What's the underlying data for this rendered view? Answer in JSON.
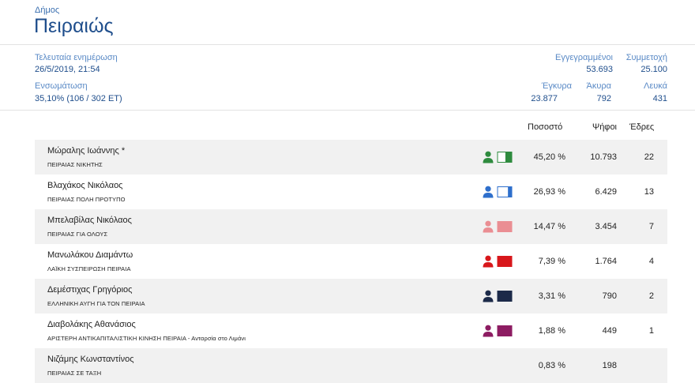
{
  "header": {
    "kind": "Δήμος",
    "title": "Πειραιώς"
  },
  "info": {
    "last_update_label": "Τελευταία ενημέρωση",
    "last_update_value": "26/5/2019, 21:54",
    "integration_label": "Ενσωμάτωση",
    "integration_value": "35,10% (106 / 302 ΕΤ)",
    "registered_label": "Εγγεγραμμένοι",
    "registered_value": "53.693",
    "turnout_label": "Συμμετοχή",
    "turnout_value": "25.100",
    "valid_label": "Έγκυρα",
    "valid_value": "23.877",
    "invalid_label": "Άκυρα",
    "invalid_value": "792",
    "blank_label": "Λευκά",
    "blank_value": "431"
  },
  "table": {
    "headers": {
      "percent": "Ποσοστό",
      "votes": "Ψήφοι",
      "seats": "Έδρες"
    },
    "rows": [
      {
        "name": "Μώραλης Ιωάννης *",
        "party": "ΠΕΙΡΑΙΑΣ ΝΙΚΗΤΗΣ",
        "color": "#2e8b3e",
        "fill": 0.45,
        "percent": "45,20 %",
        "votes": "10.793",
        "seats": "22"
      },
      {
        "name": "Βλαχάκος Νικόλαος",
        "party": "ΠΕΙΡΑΙΑΣ ΠΟΛΗ ΠΡΟΤΥΠΟ",
        "color": "#2e6fcc",
        "fill": 0.27,
        "percent": "26,93 %",
        "votes": "6.429",
        "seats": "13"
      },
      {
        "name": "Μπελαβίλας Νικόλαος",
        "party": "ΠΕΙΡΑΙΑΣ ΓΙΑ ΟΛΟΥΣ",
        "color": "#ea8e93",
        "fill": 1.0,
        "percent": "14,47 %",
        "votes": "3.454",
        "seats": "7"
      },
      {
        "name": "Μανωλάκου Διαμάντω",
        "party": "ΛΑΪΚΗ ΣΥΣΠΕΙΡΩΣΗ ΠΕΙΡΑΙΑ",
        "color": "#d8171b",
        "fill": 1.0,
        "percent": "7,39 %",
        "votes": "1.764",
        "seats": "4"
      },
      {
        "name": "Δεμέστιχας Γρηγόριος",
        "party": "ΕΛΛΗΝΙΚΗ ΑΥΓΗ ΓΙΑ ΤΟΝ ΠΕΙΡΑΙΑ",
        "color": "#1c2a49",
        "fill": 1.0,
        "percent": "3,31 %",
        "votes": "790",
        "seats": "2"
      },
      {
        "name": "Διαβολάκης Αθανάσιος",
        "party": "ΑΡΙΣΤΕΡΗ ΑΝΤΙΚΑΠΙΤΑΛΙΣΤΙΚΗ ΚΙΝΗΣΗ ΠΕΙΡΑΙΑ - Ανταρσία στο Λιμάνι",
        "color": "#8d1c62",
        "fill": 1.0,
        "percent": "1,88 %",
        "votes": "449",
        "seats": "1"
      },
      {
        "name": "Νιζάμης Κωνσταντίνος",
        "party": "ΠΕΙΡΑΙΑΣ ΣΕ ΤΑΞΗ",
        "color": "",
        "fill": 0,
        "percent": "0,83 %",
        "votes": "198",
        "seats": ""
      }
    ]
  }
}
